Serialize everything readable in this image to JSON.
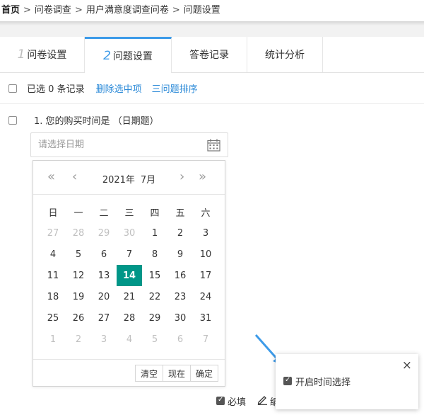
{
  "breadcrumb": {
    "home": "首页",
    "sep": ">",
    "items": [
      "问卷调查",
      "用户满意度调查问卷",
      "问题设置"
    ]
  },
  "tabs": [
    {
      "num": "1",
      "label": "问卷设置",
      "active": false
    },
    {
      "num": "2",
      "label": "问题设置",
      "active": true
    },
    {
      "label": "答卷记录",
      "active": false
    },
    {
      "label": "统计分析",
      "active": false
    }
  ],
  "toolbar": {
    "selected_prefix": "已选",
    "selected_count": "0",
    "selected_suffix": "条记录",
    "delete_label": "删除选中项",
    "sort_label": "三问题排序"
  },
  "question": {
    "title": "1. 您的购买时间是 （日期题）",
    "date_placeholder": "请选择日期"
  },
  "calendar": {
    "nav_prev_year": "«",
    "nav_prev_month": "‹",
    "nav_next_month": "›",
    "nav_next_year": "»",
    "year": "2021年",
    "month": "7月",
    "weekdays": [
      "日",
      "一",
      "二",
      "三",
      "四",
      "五",
      "六"
    ],
    "weeks": [
      [
        {
          "d": "27",
          "o": 1
        },
        {
          "d": "28",
          "o": 1
        },
        {
          "d": "29",
          "o": 1
        },
        {
          "d": "30",
          "o": 1
        },
        {
          "d": "1"
        },
        {
          "d": "2"
        },
        {
          "d": "3"
        }
      ],
      [
        {
          "d": "4"
        },
        {
          "d": "5"
        },
        {
          "d": "6"
        },
        {
          "d": "7"
        },
        {
          "d": "8"
        },
        {
          "d": "9"
        },
        {
          "d": "10"
        }
      ],
      [
        {
          "d": "11"
        },
        {
          "d": "12"
        },
        {
          "d": "13"
        },
        {
          "d": "14",
          "t": 1
        },
        {
          "d": "15"
        },
        {
          "d": "16"
        },
        {
          "d": "17"
        }
      ],
      [
        {
          "d": "18"
        },
        {
          "d": "19"
        },
        {
          "d": "20"
        },
        {
          "d": "21"
        },
        {
          "d": "22"
        },
        {
          "d": "23"
        },
        {
          "d": "24"
        }
      ],
      [
        {
          "d": "25"
        },
        {
          "d": "26"
        },
        {
          "d": "27"
        },
        {
          "d": "28"
        },
        {
          "d": "29"
        },
        {
          "d": "30"
        },
        {
          "d": "31"
        }
      ],
      [
        {
          "d": "1",
          "o": 1
        },
        {
          "d": "2",
          "o": 1
        },
        {
          "d": "3",
          "o": 1
        },
        {
          "d": "4",
          "o": 1
        },
        {
          "d": "5",
          "o": 1
        },
        {
          "d": "6",
          "o": 1
        },
        {
          "d": "7",
          "o": 1
        }
      ]
    ],
    "buttons": [
      "清空",
      "现在",
      "确定"
    ]
  },
  "popover": {
    "close": "×",
    "option_label": "开启时间选择",
    "option_checked": true
  },
  "bottom": {
    "required_label": "必填",
    "required_checked": true,
    "edit_label": "编"
  },
  "colors": {
    "accent": "#3d9be9",
    "link": "#2b8ad8",
    "today": "#009688"
  }
}
